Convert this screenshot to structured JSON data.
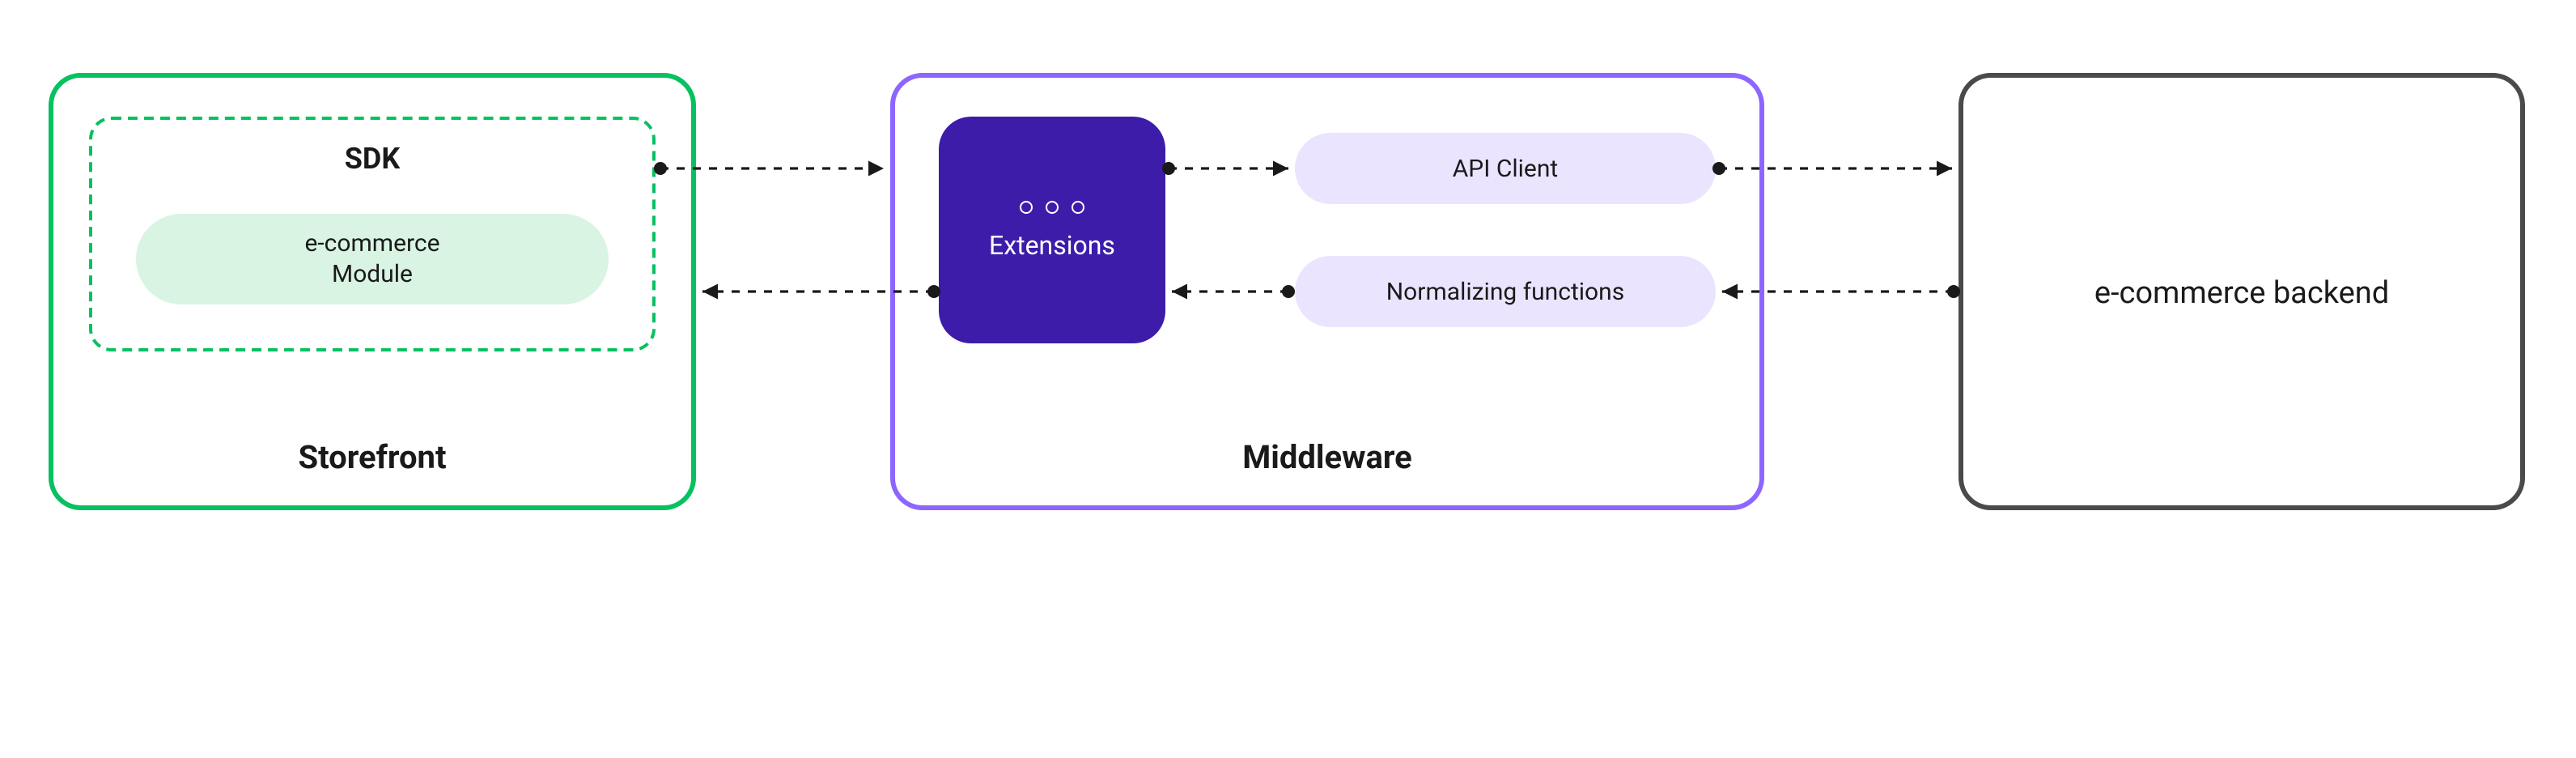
{
  "storefront": {
    "title": "Storefront",
    "sdk_title": "SDK",
    "module_line1": "e-commerce",
    "module_line2": "Module"
  },
  "middleware": {
    "title": "Middleware",
    "extensions_label": "Extensions",
    "api_client_label": "API Client",
    "normalizing_label": "Normalizing functions"
  },
  "backend": {
    "title": "e-commerce backend"
  },
  "colors": {
    "storefront_border": "#07c160",
    "module_fill": "#d9f4e3",
    "middleware_border": "#8c66ff",
    "extensions_fill": "#3d1caa",
    "mw_pill_fill": "#ebe4ff",
    "backend_border": "#4a4a4a",
    "arrow": "#1a1a1a"
  }
}
